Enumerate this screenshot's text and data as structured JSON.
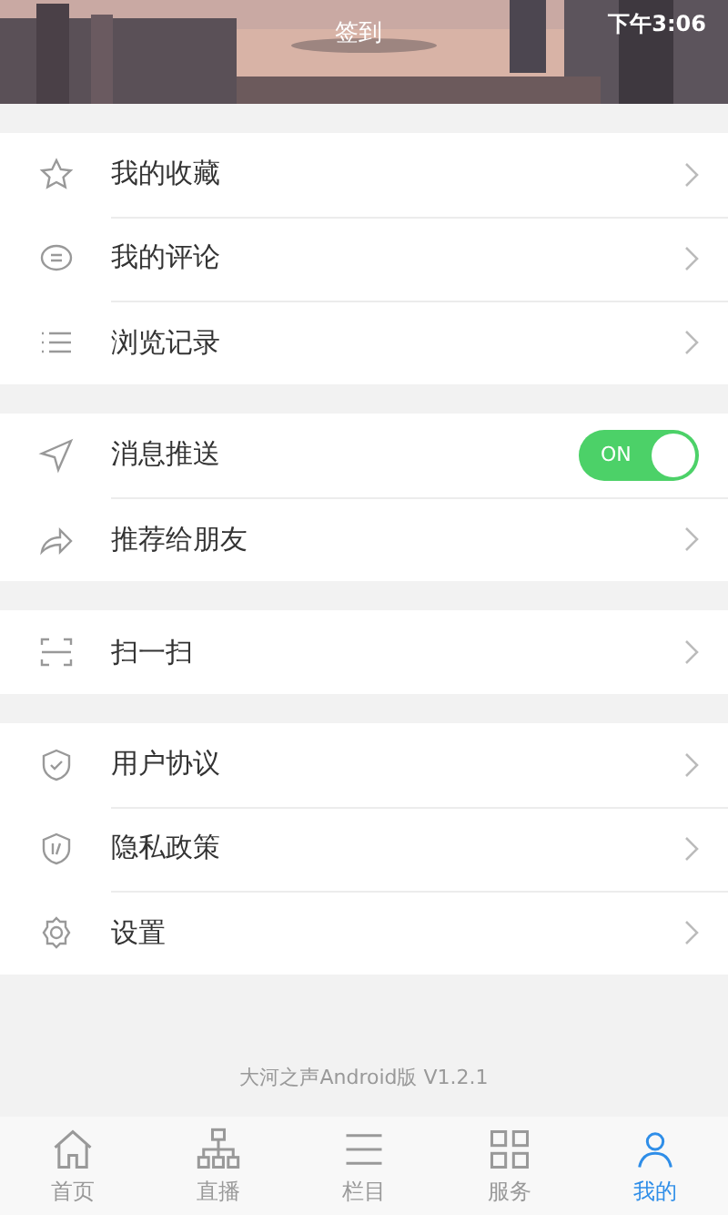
{
  "header": {
    "status_time": "下午3:06",
    "checkin_label": "签到"
  },
  "groups": [
    {
      "items": [
        {
          "kind": "link",
          "label": "我的收藏"
        },
        {
          "kind": "link",
          "label": "我的评论"
        },
        {
          "kind": "link",
          "label": "浏览记录"
        }
      ]
    },
    {
      "items": [
        {
          "kind": "toggle",
          "label": "消息推送",
          "on": true,
          "toggle_text": "ON"
        },
        {
          "kind": "link",
          "label": "推荐给朋友"
        }
      ]
    },
    {
      "items": [
        {
          "kind": "link",
          "label": "扫一扫"
        }
      ]
    },
    {
      "items": [
        {
          "kind": "link",
          "label": "用户协议"
        },
        {
          "kind": "link",
          "label": "隐私政策"
        },
        {
          "kind": "link",
          "label": "设置"
        }
      ]
    }
  ],
  "version": "大河之声Android版 V1.2.1",
  "tabs": [
    {
      "label": "首页",
      "selected": false
    },
    {
      "label": "直播",
      "selected": false
    },
    {
      "label": "栏目",
      "selected": false
    },
    {
      "label": "服务",
      "selected": false
    },
    {
      "label": "我的",
      "selected": true
    }
  ]
}
